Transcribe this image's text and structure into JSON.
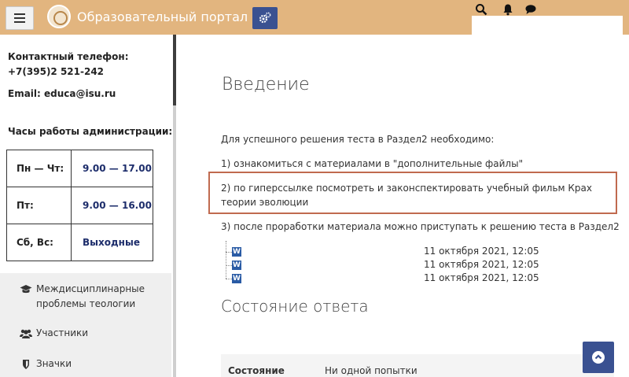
{
  "header": {
    "site_title": "Образовательный портал ИГУ",
    "menu_icon": "hamburger-icon",
    "settings_icon": "gear-icon",
    "search_icon": "search-icon",
    "notifications_icon": "bell-icon",
    "messages_icon": "chat-icon"
  },
  "sidebar": {
    "contact_label": "Контактный телефон:",
    "contact_phone": "+7(395)2 521-242",
    "email_label": "Email:",
    "email_value": "educa@isu.ru",
    "hours_title": "Часы работы администрации:",
    "hours": [
      {
        "day": "Пн — Чт:",
        "time": "9.00 — 17.00"
      },
      {
        "day": "Пт:",
        "time": "9.00 — 16.00"
      },
      {
        "day": "Сб, Вс:",
        "time": "Выходные"
      }
    ],
    "nav": [
      {
        "label": "Междисциплинарные проблемы теологии",
        "icon": "graduation-cap-icon"
      },
      {
        "label": "Участники",
        "icon": "users-icon"
      },
      {
        "label": "Значки",
        "icon": "shield-icon"
      }
    ]
  },
  "main": {
    "title": "Введение",
    "intro": "Для успешного решения теста в Раздел2 необходимо:",
    "step1": "1) ознакомиться с материалами в \"дополнительные файлы\"",
    "step2": "2) по гиперссылке посмотреть и законспектировать учебный фильм Крах теории эволюции",
    "step3": "3) после проработки материала можно приступать к решению теста в Раздел2",
    "files": [
      {
        "icon": "word-file-icon",
        "date": "11 октября 2021, 12:05"
      },
      {
        "icon": "word-file-icon",
        "date": "11 октября 2021, 12:05"
      },
      {
        "icon": "word-file-icon",
        "date": "11 октября 2021, 12:05"
      }
    ],
    "section_title": "Состояние ответа",
    "status_label": "Состояние",
    "status_value": "Ни одной попытки"
  },
  "colors": {
    "navbar": "#e2b57f",
    "accent_blue": "#3a5191",
    "highlight_border": "#c06a4f"
  }
}
